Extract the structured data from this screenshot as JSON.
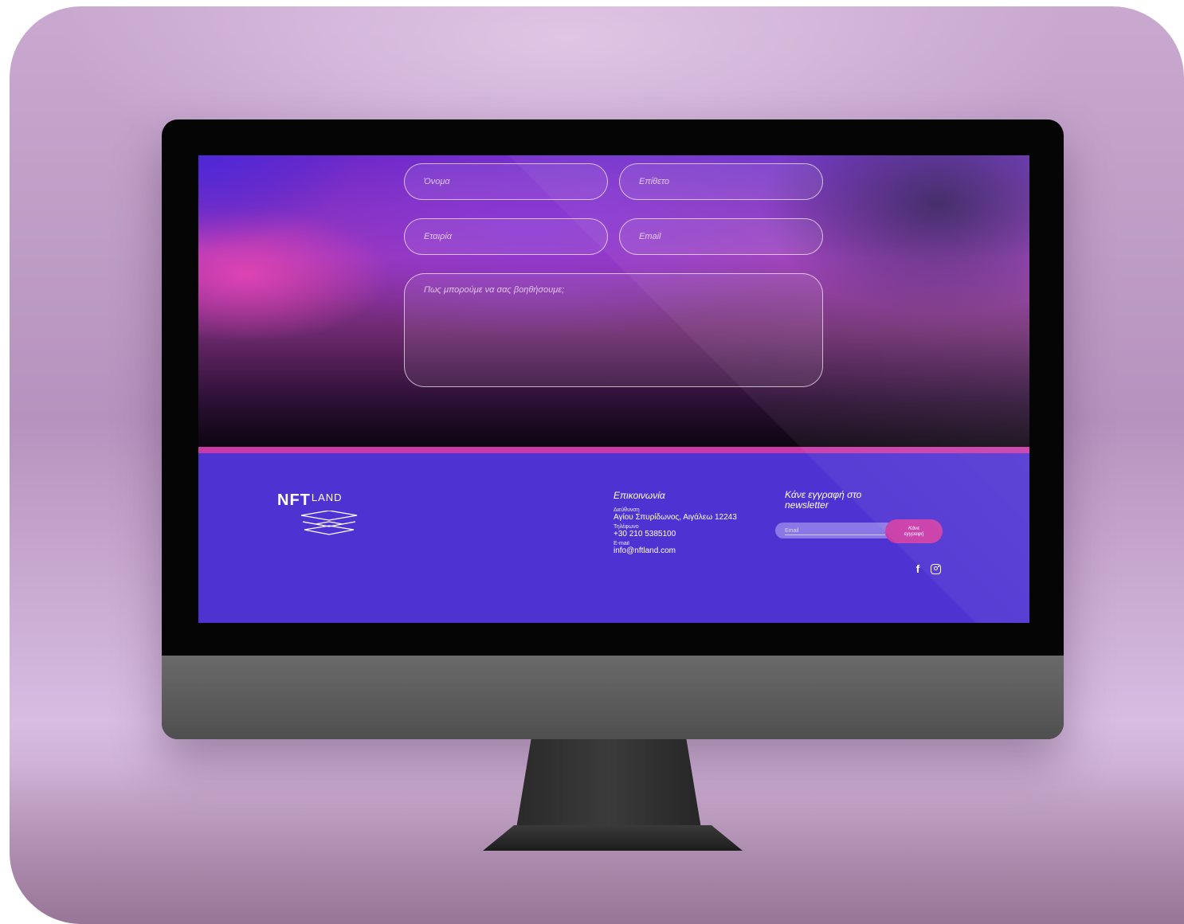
{
  "form": {
    "first_name_placeholder": "Όνομα",
    "last_name_placeholder": "Επίθετο",
    "company_placeholder": "Εταιρία",
    "email_placeholder": "Email",
    "message_placeholder": "Πως μπορούμε να σας βοηθήσουμε;"
  },
  "footer": {
    "logo": {
      "main": "NFT",
      "sub": "LAND"
    },
    "contact": {
      "title": "Επικοινωνία",
      "address_label": "Διεύθυνση",
      "address": "Αγίου Σπυρίδωνος, Αιγάλεω 12243",
      "phone_label": "Τηλέφωνο",
      "phone": "+30 210 5385100",
      "email_label": "E-mail",
      "email": "info@nftland.com"
    },
    "newsletter": {
      "title": "Κάνε εγγραφή στο newsletter",
      "input_placeholder": "Email",
      "button_label": "Κάνε εγγραφή"
    },
    "socials": [
      "facebook-icon",
      "instagram-icon"
    ]
  },
  "colors": {
    "footer_bg": "#4f33d2",
    "accent": "#c83aa8"
  }
}
